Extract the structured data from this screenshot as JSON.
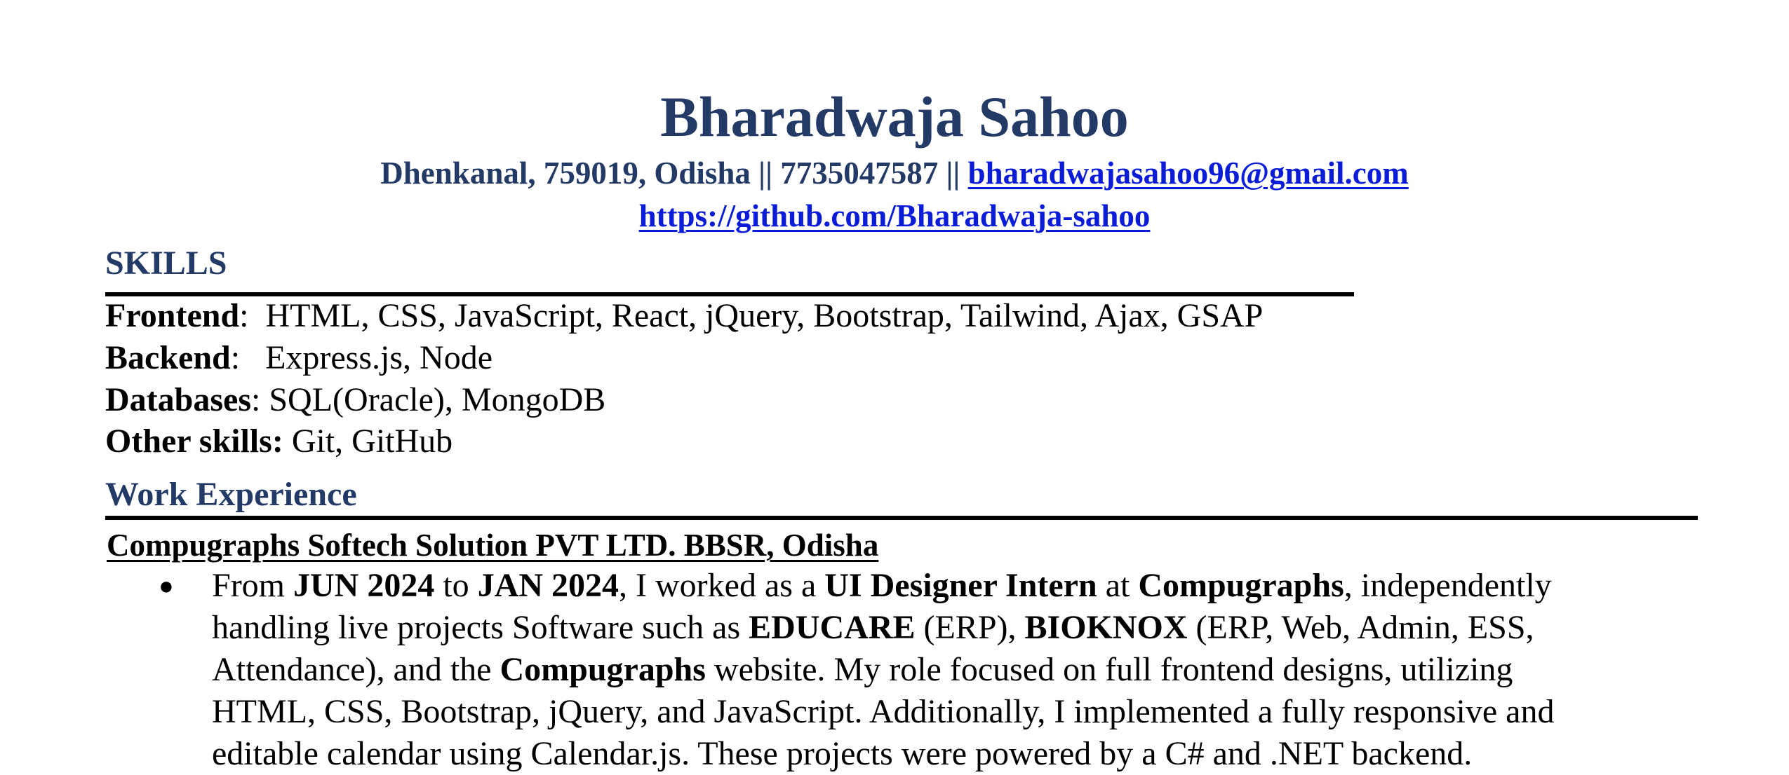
{
  "header": {
    "name": "Bharadwaja Sahoo",
    "location": "Dhenkanal, 759019, Odisha",
    "separator": " || ",
    "phone": "7735047587",
    "email": "bharadwajasahoo96@gmail.com",
    "github": "https://github.com/Bharadwaja-sahoo"
  },
  "skills": {
    "heading": "SKILLS",
    "rows": [
      {
        "label": "Frontend",
        "sep": ":  ",
        "value": "HTML, CSS, JavaScript, React, jQuery, Bootstrap, Tailwind, Ajax, GSAP"
      },
      {
        "label": "Backend",
        "sep": ":   ",
        "value": "Express.js, Node"
      },
      {
        "label": "Databases",
        "sep": ": ",
        "value": "SQL(Oracle), MongoDB"
      },
      {
        "label": "Other skills:",
        "sep": " ",
        "value": "Git, GitHub"
      }
    ]
  },
  "experience": {
    "heading": "Work Experience",
    "company": "Compugraphs Softech Solution PVT LTD. BBSR, Odisha",
    "bullet_symbol": "●",
    "lines": [
      [
        {
          "t": "From ",
          "b": false
        },
        {
          "t": "JUN 2024",
          "b": true
        },
        {
          "t": " to ",
          "b": false
        },
        {
          "t": "JAN 2024",
          "b": true
        },
        {
          "t": ", I worked as a ",
          "b": false
        },
        {
          "t": "UI Designer Intern",
          "b": true
        },
        {
          "t": " at ",
          "b": false
        },
        {
          "t": "Compugraphs",
          "b": true
        },
        {
          "t": ", independently",
          "b": false
        }
      ],
      [
        {
          "t": "handling live projects Software such as ",
          "b": false
        },
        {
          "t": "EDUCARE",
          "b": true
        },
        {
          "t": " (ERP), ",
          "b": false
        },
        {
          "t": "BIOKNOX",
          "b": true
        },
        {
          "t": " (ERP, Web, Admin, ESS,",
          "b": false
        }
      ],
      [
        {
          "t": "Attendance), and the ",
          "b": false
        },
        {
          "t": "Compugraphs",
          "b": true
        },
        {
          "t": " website. My role focused on full frontend designs, utilizing",
          "b": false
        }
      ],
      [
        {
          "t": "HTML, CSS, Bootstrap, jQuery, and JavaScript. Additionally, I implemented a fully responsive and",
          "b": false
        }
      ],
      [
        {
          "t": "editable calendar using Calendar.js. These projects were powered by a C# and .NET backend.",
          "b": false
        }
      ]
    ]
  }
}
